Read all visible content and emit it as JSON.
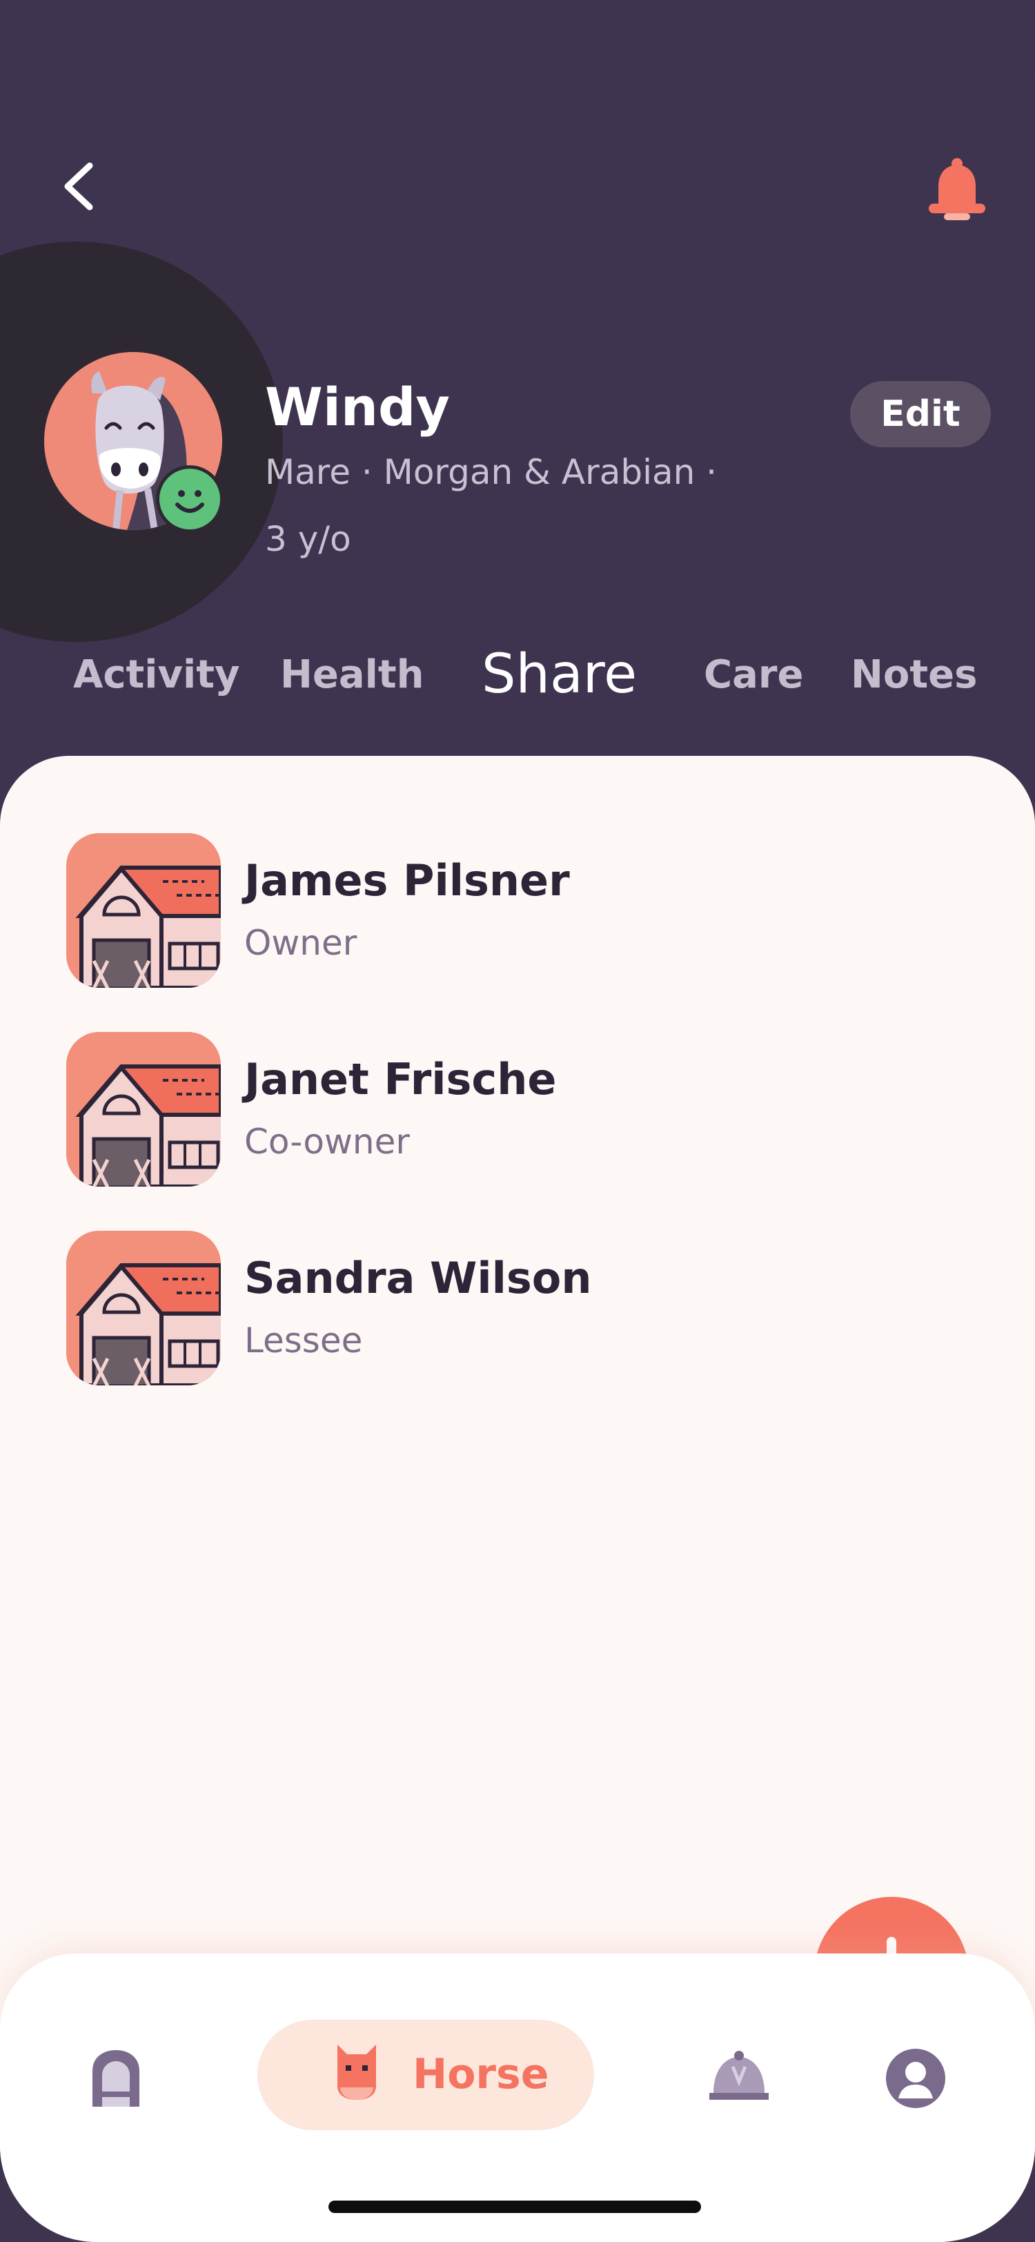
{
  "header": {
    "horse_name": "Windy",
    "meta_line1": "Mare  ·  Morgan & Arabian  ·",
    "meta_line2": "3 y/o",
    "edit_label": "Edit"
  },
  "tabs": [
    {
      "label": "Activity",
      "active": false
    },
    {
      "label": "Health",
      "active": false
    },
    {
      "label": "Share",
      "active": true
    },
    {
      "label": "Care",
      "active": false
    },
    {
      "label": "Notes",
      "active": false
    }
  ],
  "shares": [
    {
      "name": "James Pilsner",
      "role": "Owner"
    },
    {
      "name": "Janet Frische",
      "role": "Co-owner"
    },
    {
      "name": "Sandra Wilson",
      "role": "Lessee"
    }
  ],
  "nav": {
    "items": [
      {
        "name": "barn-icon"
      },
      {
        "name": "horse-icon",
        "label": "Horse",
        "active": true
      },
      {
        "name": "riding-helmet-icon"
      },
      {
        "name": "profile-icon"
      }
    ]
  },
  "colors": {
    "header_bg": "#3f3450",
    "accent": "#f47461",
    "content_bg": "#fdf7f5",
    "status_green": "#5ec27c"
  }
}
